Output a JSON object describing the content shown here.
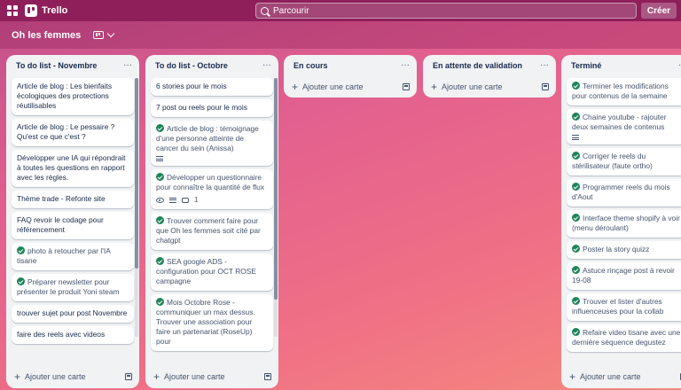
{
  "app": {
    "name": "Trello"
  },
  "search": {
    "placeholder": "Parcourir"
  },
  "header": {
    "create_label": "Créer"
  },
  "board": {
    "title": "Oh les femmes"
  },
  "add_card_label": "Ajouter une carte",
  "lists": [
    {
      "title": "To do list - Novembre",
      "cards": [
        {
          "text": "Article de blog : Les bienfaits écologiques des protections réutilisables",
          "done": false
        },
        {
          "text": "Article de blog : Le pessaire ? Qu'est ce que c'est ?",
          "done": false
        },
        {
          "text": "Développer une IA qui répondrait à toutes les questions en rapport avec les règles.",
          "done": false
        },
        {
          "text": "Thème trade - Refonte site",
          "done": false
        },
        {
          "text": "FAQ revoir le codage pour référencement",
          "done": false
        },
        {
          "text": "photo à retoucher par l'IA tisane",
          "done": true
        },
        {
          "text": "Préparer newsletter pour présenter le produit Yoni steam",
          "done": true
        },
        {
          "text": "trouver sujet pour post Novembre",
          "done": false
        },
        {
          "text": "faire des reels avec videos",
          "done": false
        }
      ]
    },
    {
      "title": "To do list - Octobre",
      "cards": [
        {
          "text": "6 stories pour le mois",
          "done": false
        },
        {
          "text": "7 post ou reels pour le mois",
          "done": false
        },
        {
          "text": "Article de blog : témoignage d'une personne atteinte de cancer du sein (Anissa)",
          "done": true,
          "description": true
        },
        {
          "text": "Développer un questionnaire pour connaître la quantité de flux",
          "done": true,
          "watch": true,
          "description": true,
          "comments": "1"
        },
        {
          "text": "Trouver comment faire pour que Oh les femmes soit cité par chatgpt",
          "done": true
        },
        {
          "text": "SEA google ADS - configuration pour OCT ROSE campagne",
          "done": true
        },
        {
          "text": "Mois Octobre Rose - communiquer un max dessus. Trouver une association pour faire un partenariat (RoseUp) pour",
          "done": true
        }
      ]
    },
    {
      "title": "En cours",
      "cards": []
    },
    {
      "title": "En attente de validation",
      "cards": []
    },
    {
      "title": "Terminé",
      "cards": [
        {
          "text": "Terminer les modifications pour contenus de la semaine",
          "done": true
        },
        {
          "text": "Chaine youtube - rajouter deux semaines de contenus",
          "done": true,
          "description": true
        },
        {
          "text": "Corriger le reels du stérilisateur (faute ortho)",
          "done": true
        },
        {
          "text": "Programmer reels du mois d'Aout",
          "done": true
        },
        {
          "text": "Interface theme shopify à voir (menu déroulant)",
          "done": true
        },
        {
          "text": "Poster la story quizz",
          "done": true
        },
        {
          "text": "Astuce rinçage post à revoir 19-08",
          "done": true
        },
        {
          "text": "Trouver et lister d'autres influenceuses pour la collab",
          "done": true
        },
        {
          "text": "Refaire video tisane avec une dernière séquence degustez",
          "done": true
        }
      ]
    }
  ]
}
